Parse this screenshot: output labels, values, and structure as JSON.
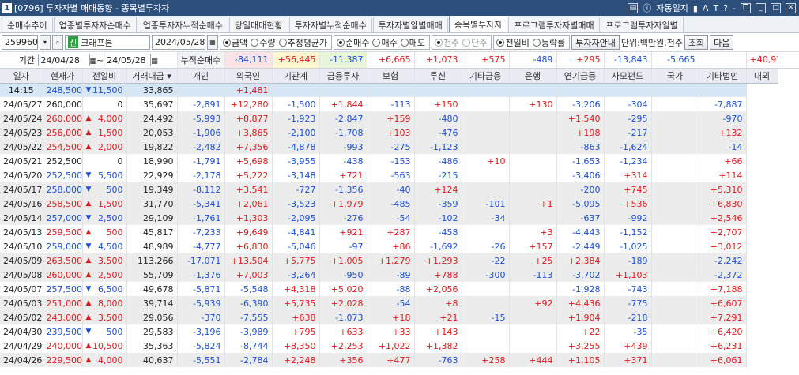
{
  "title": {
    "num": "1",
    "text": "[0796] 투자자별 매매동향 - 종목별투자자",
    "autolog": "자동일지"
  },
  "tabs": [
    "순매수추이",
    "업종별투자자순매수",
    "업종투자자누적순매수",
    "당일매매현황",
    "투자자별누적순매수",
    "투자자별일별매매",
    "종목별투자자",
    "프로그램투자자별매매",
    "프로그램투자자일별"
  ],
  "active_tab": 6,
  "controls": {
    "code": "259960",
    "badge": "신",
    "name": "크래프톤",
    "date": "2024/05/28",
    "opt1": [
      "금액",
      "수량",
      "추정평균가"
    ],
    "opt2": [
      "순매수",
      "매수",
      "매도"
    ],
    "opt3": [
      "천주",
      "단주"
    ],
    "opt4": [
      "전일비",
      "등락률"
    ],
    "btn_info": "투자자안내",
    "unit": "단위:백만원,천주",
    "btn_query": "조회",
    "btn_next": "다음"
  },
  "period": {
    "label": "기간",
    "from": "24/04/28",
    "tilde": "~",
    "to": "24/05/28",
    "cum_label": "누적순매수"
  },
  "sums": [
    "-84,111",
    "+56,445",
    "-11,387",
    "+6,665",
    "+1,073",
    "+575",
    "-489",
    "+295",
    "-13,843",
    "-5,665",
    "",
    "+40,971",
    ""
  ],
  "headers": [
    "일자",
    "현재가",
    "전일비",
    "거래대금",
    "개인",
    "외국인",
    "기관계",
    "금융투자",
    "보험",
    "투신",
    "기타금융",
    "은행",
    "연기금등",
    "사모펀드",
    "국가",
    "기타법인",
    "내외"
  ],
  "rows": [
    [
      "14:15",
      "248,500",
      "dn",
      "11,500",
      "33,865",
      "",
      "+1,481",
      "",
      "",
      "",
      "",
      "",
      "",
      "",
      "",
      "",
      ""
    ],
    [
      "24/05/27",
      "260,000",
      "",
      "0",
      "35,697",
      "-2,891",
      "+12,280",
      "-1,500",
      "+1,844",
      "-113",
      "+150",
      "",
      "+130",
      "-3,206",
      "-304",
      "",
      "-7,887"
    ],
    [
      "24/05/24",
      "260,000",
      "up",
      "4,000",
      "24,492",
      "-5,993",
      "+8,877",
      "-1,923",
      "-2,847",
      "+159",
      "-480",
      "",
      "",
      "+1,540",
      "-295",
      "",
      "-970"
    ],
    [
      "24/05/23",
      "256,000",
      "up",
      "1,500",
      "20,053",
      "-1,906",
      "+3,865",
      "-2,100",
      "-1,708",
      "+103",
      "-476",
      "",
      "",
      "+198",
      "-217",
      "",
      "+132"
    ],
    [
      "24/05/22",
      "254,500",
      "up",
      "2,000",
      "19,822",
      "-2,482",
      "+7,356",
      "-4,878",
      "-993",
      "-275",
      "-1,123",
      "",
      "",
      "-863",
      "-1,624",
      "",
      "-14"
    ],
    [
      "24/05/21",
      "252,500",
      "",
      "0",
      "18,990",
      "-1,791",
      "+5,698",
      "-3,955",
      "-438",
      "-153",
      "-486",
      "+10",
      "",
      "-1,653",
      "-1,234",
      "",
      "+66"
    ],
    [
      "24/05/20",
      "252,500",
      "dn",
      "5,500",
      "22,929",
      "-2,178",
      "+5,222",
      "-3,148",
      "+721",
      "-563",
      "-215",
      "",
      "",
      "-3,406",
      "+314",
      "",
      "+114"
    ],
    [
      "24/05/17",
      "258,000",
      "dn",
      "500",
      "19,349",
      "-8,112",
      "+3,541",
      "-727",
      "-1,356",
      "-40",
      "+124",
      "",
      "",
      "-200",
      "+745",
      "",
      "+5,310"
    ],
    [
      "24/05/16",
      "258,500",
      "up",
      "1,500",
      "31,770",
      "-5,341",
      "+2,061",
      "-3,523",
      "+1,979",
      "-485",
      "-359",
      "-101",
      "+1",
      "-5,095",
      "+536",
      "",
      "+6,830"
    ],
    [
      "24/05/14",
      "257,000",
      "dn",
      "2,500",
      "29,109",
      "-1,761",
      "+1,303",
      "-2,095",
      "-276",
      "-54",
      "-102",
      "-34",
      "",
      "-637",
      "-992",
      "",
      "+2,546"
    ],
    [
      "24/05/13",
      "259,500",
      "up",
      "500",
      "45,817",
      "-7,233",
      "+9,649",
      "-4,841",
      "+921",
      "+287",
      "-458",
      "",
      "+3",
      "-4,443",
      "-1,152",
      "",
      "+2,707"
    ],
    [
      "24/05/10",
      "259,000",
      "dn",
      "4,500",
      "48,989",
      "-4,777",
      "+6,830",
      "-5,046",
      "-97",
      "+86",
      "-1,692",
      "-26",
      "+157",
      "-2,449",
      "-1,025",
      "",
      "+3,012"
    ],
    [
      "24/05/09",
      "263,500",
      "up",
      "3,500",
      "113,266",
      "-17,071",
      "+13,504",
      "+5,775",
      "+1,005",
      "+1,279",
      "+1,293",
      "-22",
      "+25",
      "+2,384",
      "-189",
      "",
      "-2,242"
    ],
    [
      "24/05/08",
      "260,000",
      "up",
      "2,500",
      "55,709",
      "-1,376",
      "+7,003",
      "-3,264",
      "-950",
      "-89",
      "+788",
      "-300",
      "-113",
      "-3,702",
      "+1,103",
      "",
      "-2,372"
    ],
    [
      "24/05/07",
      "257,500",
      "dn",
      "6,500",
      "49,678",
      "-5,871",
      "-5,548",
      "+4,318",
      "+5,020",
      "-88",
      "+2,056",
      "",
      "",
      "-1,928",
      "-743",
      "",
      "+7,188"
    ],
    [
      "24/05/03",
      "251,000",
      "up",
      "8,000",
      "39,714",
      "-5,939",
      "-6,390",
      "+5,735",
      "+2,028",
      "-54",
      "+8",
      "",
      "+92",
      "+4,436",
      "-775",
      "",
      "+6,607"
    ],
    [
      "24/05/02",
      "243,000",
      "up",
      "3,500",
      "29,056",
      "-370",
      "-7,555",
      "+638",
      "-1,073",
      "+18",
      "+21",
      "-15",
      "",
      "+1,904",
      "-218",
      "",
      "+7,291"
    ],
    [
      "24/04/30",
      "239,500",
      "dn",
      "500",
      "29,583",
      "-3,196",
      "-3,989",
      "+795",
      "+633",
      "+33",
      "+143",
      "",
      "",
      "+22",
      "-35",
      "",
      "+6,420"
    ],
    [
      "24/04/29",
      "240,000",
      "up",
      "10,500",
      "35,363",
      "-5,824",
      "-8,744",
      "+8,350",
      "+2,253",
      "+1,022",
      "+1,382",
      "",
      "",
      "+3,255",
      "+439",
      "",
      "+6,231"
    ],
    [
      "24/04/26",
      "229,500",
      "up",
      "4,000",
      "40,637",
      "-5,551",
      "-2,784",
      "+2,248",
      "+356",
      "+477",
      "-763",
      "+258",
      "+444",
      "+1,105",
      "+371",
      "",
      "+6,061"
    ]
  ],
  "colors": {
    "up": "#e0191c",
    "down": "#1b4fd6",
    "title_bg": "#2d4f7c"
  }
}
